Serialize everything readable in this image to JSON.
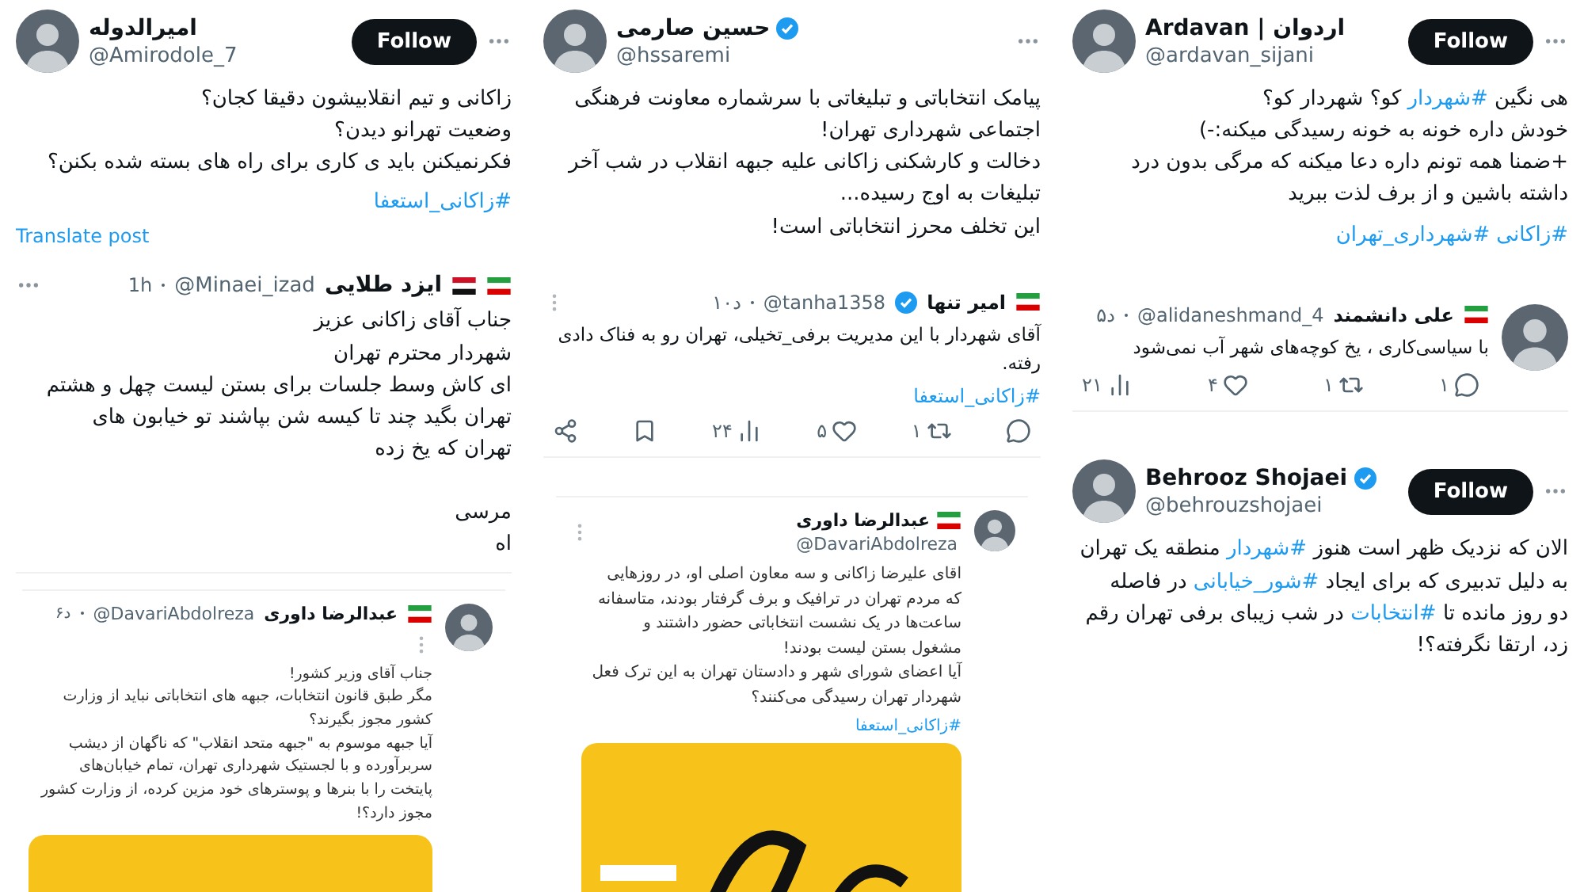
{
  "columns": [
    {
      "posts": [
        {
          "kind": "tweet",
          "avatar": {
            "kind": "avatar"
          },
          "name": "Ardavan | اردوان",
          "handle": "@ardavan_sijani",
          "follow": "Follow",
          "menu": {
            "kind": "horizontal"
          },
          "body": [
            {
              "kind": "text",
              "text": "هی نگین "
            },
            {
              "kind": "hashtag",
              "text": "#شهردار"
            },
            {
              "kind": "text",
              "text": " کو؟ شهردار کو؟\nخودش داره خونه به خونه رسیدگی میکنه:-)\n+ضمنا همه تونم داره دعا میکنه که مرگی بدون درد\nداشته باشین و از برف لذت ببرید"
            }
          ],
          "hashtags": [
            "#زاکانی",
            "#شهرداری_تهران"
          ]
        },
        {
          "kind": "reply",
          "avatar": {
            "kind": "avatar"
          },
          "flags": [
            {
              "kind": "iran"
            }
          ],
          "name": "علی دانشمند",
          "handle": "@alidaneshmand_4",
          "time": "۵د",
          "body": [
            {
              "kind": "text",
              "text": "با سیاسی‌کاری ، یخ کوچه‌های شهر آب نمی‌شود"
            }
          ],
          "actions": [
            {
              "kind": "reply",
              "count": "۱"
            },
            {
              "kind": "repost",
              "count": "۱"
            },
            {
              "kind": "like",
              "count": "۴"
            },
            {
              "kind": "views",
              "count": "۲۱"
            }
          ]
        },
        {
          "kind": "tweet",
          "avatar": {
            "kind": "avatar"
          },
          "name": "Behrooz Shojaei",
          "handle": "@behrouzshojaei",
          "verified": true,
          "follow": "Follow",
          "menu": {
            "kind": "horizontal"
          },
          "body": [
            {
              "kind": "text",
              "text": "الان که نزدیک ظهر است هنوز "
            },
            {
              "kind": "hashtag",
              "text": "#شهردار"
            },
            {
              "kind": "text",
              "text": " منطقه یک تهران\nبه دلیل تدبیری که برای ایجاد "
            },
            {
              "kind": "hashtag",
              "text": "#شور_خیابانی"
            },
            {
              "kind": "text",
              "text": " در فاصله\nدو روز مانده تا "
            },
            {
              "kind": "hashtag",
              "text": "#انتخابات"
            },
            {
              "kind": "text",
              "text": " در شب زیبای برفی تهران رقم\nزد، ارتقا نگرفته؟!"
            }
          ]
        }
      ]
    },
    {
      "posts": [
        {
          "kind": "tweet",
          "avatar": {
            "kind": "avatar"
          },
          "name": "حسین صارمی",
          "handle": "@hssaremi",
          "verified": true,
          "menu": {
            "kind": "horizontal"
          },
          "body": [
            {
              "kind": "text",
              "text": "پیامک انتخاباتی و تبلیغاتی با سرشماره معاونت فرهنگی\nاجتماعی شهرداری تهران!\nدخالت و کارشکنی زاکانی علیه جبهه انقلاب در شب آخر\nتبلیغات به اوج رسیده...\nاین تخلف محرز انتخاباتی است!"
            }
          ]
        },
        {
          "kind": "reply",
          "flags": [
            {
              "kind": "iran"
            }
          ],
          "name": "امیر تنها",
          "verified": true,
          "handle": "@tanha1358",
          "time": "۱۰د",
          "menu": {
            "kind": "vertical"
          },
          "body": [
            {
              "kind": "text",
              "text": "آقای شهردار با این مدیریت برفی_تخیلی، تهران رو به فناک دادی\nرفته."
            }
          ],
          "hashtags": [
            "#زاکانی_استعفا"
          ],
          "actions": [
            {
              "kind": "reply"
            },
            {
              "kind": "repost",
              "count": "۱"
            },
            {
              "kind": "like",
              "count": "۵"
            },
            {
              "kind": "views",
              "count": "۲۴"
            },
            {
              "kind": "bookmark"
            },
            {
              "kind": "share"
            }
          ]
        },
        {
          "kind": "quote",
          "avatar": {
            "kind": "avatar"
          },
          "flags": [
            {
              "kind": "iran"
            }
          ],
          "name": "عبدالرضا داوری",
          "handle": "@DavariAbdolreza",
          "stacked": true,
          "menu": {
            "kind": "vertical"
          },
          "body": [
            {
              "kind": "text",
              "text": "اقای علیرضا زاکانی و سه معاون اصلی او، در روزهایی\nکه مردم تهران در ترافیک و برف گرفتار بودند، متاسفانه\nساعت‌ها در یک نشست انتخاباتی حضور داشتند و\nمشغول بستن لیست بودند!\nآیا اعضای شورای شهر و دادستان تهران به این ترک فعل\nشهردار تهران رسیدگی می‌کنند؟"
            }
          ],
          "hashtags": [
            "#زاکانی_استعفا"
          ],
          "media": {
            "kind": "picture"
          }
        }
      ]
    },
    {
      "posts": [
        {
          "kind": "tweet",
          "avatar": {
            "kind": "avatar"
          },
          "name": "اميرالدوله",
          "handle": "@Amirodole_7",
          "follow": "Follow",
          "menu": {
            "kind": "horizontal"
          },
          "body": [
            {
              "kind": "text",
              "text": "زاکانی و تیم انقلابیشون دقیقا کجان؟\nوضعیت تهرانو دیدن؟\nفکرنمیکنن باید ی کاری برای راه های بسته شده بکنن؟"
            }
          ],
          "hashtags": [
            "#زاکانی_استعفا"
          ],
          "translate": "Translate post"
        },
        {
          "kind": "reply",
          "flags": [
            {
              "kind": "iran"
            },
            {
              "kind": "tricolor"
            }
          ],
          "name": "ایزد طلایی",
          "handle": "@Minaei_izad",
          "time": "1h",
          "menu": {
            "kind": "horizontal"
          },
          "body": [
            {
              "kind": "text",
              "text": "جناب آقای زاکانی عزیز\nشهردار محترم تهران\nای کاش وسط جلسات برای بستن لیست چهل و هشتم\nتهران بگید چند تا کیسه شن بپاشند تو خیابون های\nتهران که یخ زده\n\nمرسی\nاه"
            }
          ]
        },
        {
          "kind": "quote",
          "avatar": {
            "kind": "avatar"
          },
          "flags": [
            {
              "kind": "iran"
            }
          ],
          "name": "عبدالرضا داوری",
          "handle": "@DavariAbdolreza",
          "time": "۶د",
          "stacked": false,
          "menu": {
            "kind": "vertical"
          },
          "body": [
            {
              "kind": "text",
              "text": "جناب آقای وزیر کشور!\nمگر طبق قانون انتخابات، جبهه های انتخاباتی نباید از وزارت کشور مجوز بگیرند؟\nآیا جبهه موسوم به \"جبهه متحد انقلاب\" که ناگهان از دیشب سربرآورده و با لجستیک شهرداری تهران، تمام خیابان‌های پایتخت را با بنرها و پوسترهای خود مزین کرده، از وزارت کشور مجوز دارد؟!"
            }
          ],
          "media": {
            "kind": "picture"
          }
        }
      ]
    }
  ]
}
